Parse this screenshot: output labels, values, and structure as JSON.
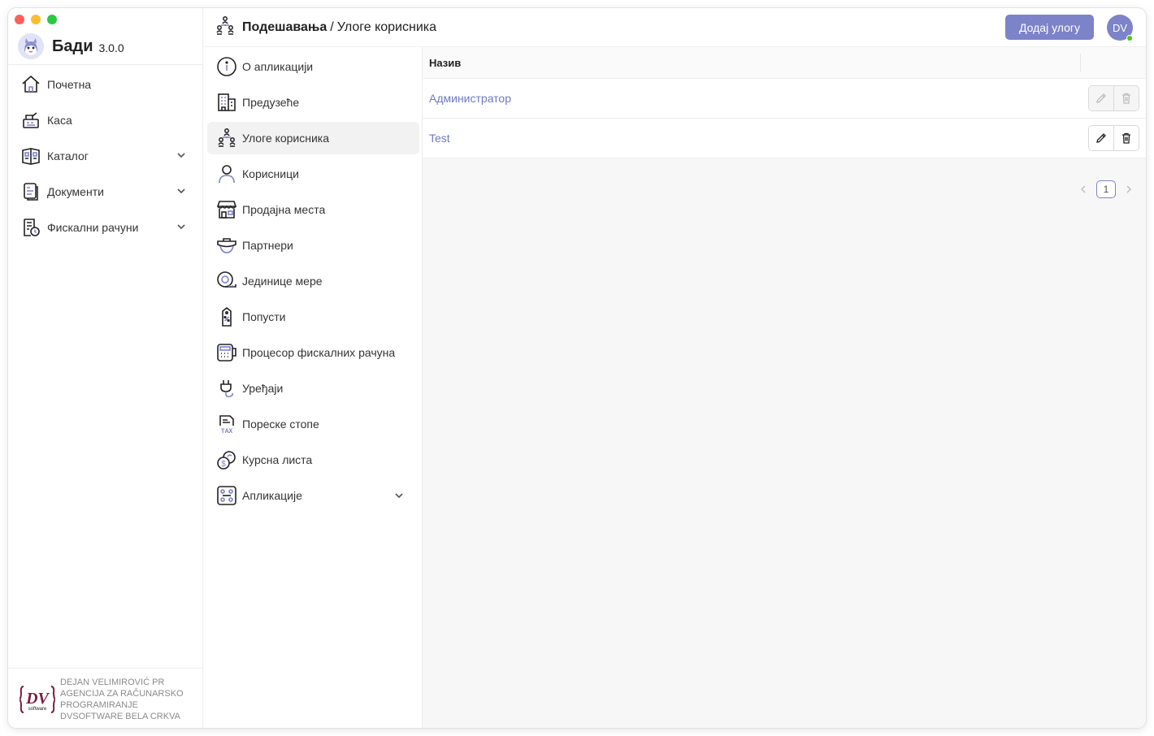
{
  "app": {
    "name": "Бади",
    "version": "3.0.0"
  },
  "sidebar": {
    "items": [
      {
        "label": "Почетна",
        "icon": "home-icon",
        "expandable": false
      },
      {
        "label": "Каса",
        "icon": "cash-register-icon",
        "expandable": false
      },
      {
        "label": "Каталог",
        "icon": "catalog-icon",
        "expandable": true
      },
      {
        "label": "Документи",
        "icon": "documents-icon",
        "expandable": true
      },
      {
        "label": "Фискални рачуни",
        "icon": "fiscal-receipts-icon",
        "expandable": true
      }
    ],
    "footer": {
      "line1": "DEJAN VELIMIROVIĆ PR",
      "line2": "AGENCIJA ZA RAČUNARSKO",
      "line3": "PROGRAMIRANJE",
      "line4": "DVSOFTWARE BELA CRKVA",
      "logo_text": "DV",
      "logo_sub": "software"
    }
  },
  "header": {
    "section": "Подешавања",
    "separator": "/",
    "page": "Улоге корисника",
    "add_button": "Додај улогу",
    "avatar_initials": "DV"
  },
  "settings_menu": {
    "active_index": 2,
    "items": [
      {
        "label": "О апликацији",
        "icon": "info-icon"
      },
      {
        "label": "Предузеће",
        "icon": "company-building-icon"
      },
      {
        "label": "Улоге корисника",
        "icon": "user-roles-icon"
      },
      {
        "label": "Корисници",
        "icon": "user-icon"
      },
      {
        "label": "Продајна места",
        "icon": "store-icon"
      },
      {
        "label": "Партнери",
        "icon": "partners-icon"
      },
      {
        "label": "Јединице мере",
        "icon": "measuring-tape-icon"
      },
      {
        "label": "Попусти",
        "icon": "discount-tag-icon"
      },
      {
        "label": "Процесор фискалних рачуна",
        "icon": "pos-terminal-icon"
      },
      {
        "label": "Уређаји",
        "icon": "device-plug-icon"
      },
      {
        "label": "Пореске стопе",
        "icon": "tax-icon"
      },
      {
        "label": "Курсна листа",
        "icon": "exchange-rate-icon"
      },
      {
        "label": "Апликације",
        "icon": "apps-icon",
        "expandable": true
      }
    ]
  },
  "table": {
    "column_name": "Назив",
    "rows": [
      {
        "name": "Администратор",
        "actions_disabled": true
      },
      {
        "name": "Test",
        "actions_disabled": false
      }
    ]
  },
  "pagination": {
    "current_page": "1"
  },
  "colors": {
    "accent": "#7d83c9",
    "link": "#6e78c4",
    "online": "#52c41a"
  }
}
